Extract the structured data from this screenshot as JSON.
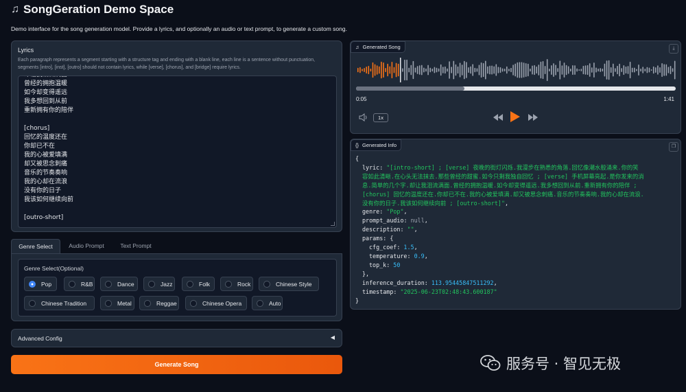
{
  "header": {
    "icon": "music-note-icon",
    "title": "SongGeration Demo Space",
    "description": "Demo interface for the song generation model. Provide a lyrics, and optionally an audio or text prompt, to generate a custom song."
  },
  "lyrics": {
    "label": "Lyrics",
    "info": "Each paragraph represents a segment starting with a structure tag and ending with a blank line, each line is a sentence without punctuation, segments [intro], [inst], [outro] should not contain lyrics, while [verse], [chorus], and [bridge] require lyrics.",
    "lines": [
      "却让我泪流满面",
      "曾经的拥抱温暖",
      "如今却变得遥远",
      "我多想回到从前",
      "重新拥有你的陪伴",
      "",
      "[chorus]",
      "回忆的温度还在",
      "你却已不在",
      "我的心被爱填满",
      "却又被思念刺痛",
      "音乐的节奏奏响",
      "我的心却在流浪",
      "没有你的日子",
      "我该如何继续向前",
      "",
      "[outro-short]"
    ]
  },
  "tabs": [
    "Genre Select",
    "Audio Prompt",
    "Text Prompt"
  ],
  "genre": {
    "title": "Genre Select(Optional)",
    "selected": "Pop",
    "options_row1": [
      "Pop",
      "R&B",
      "Dance",
      "Jazz",
      "Folk",
      "Rock",
      "Chinese Style"
    ],
    "options_row2": [
      "Chinese Tradition",
      "Metal",
      "Reggae",
      "Chinese Opera",
      "Auto"
    ]
  },
  "advanced": {
    "label": "Advanced Config",
    "arrow": "◀"
  },
  "generate_button": "Generate Song",
  "audio": {
    "label": "Generated Song",
    "current_time": "0:05",
    "duration": "1:41",
    "progress": 0.05,
    "speed": "1x",
    "icons": [
      "music-note-icon",
      "download-icon",
      "volume-icon",
      "rewind-icon",
      "play-icon",
      "fast-forward-icon"
    ]
  },
  "info": {
    "label": "Generated Info",
    "json_lines": [
      {
        "indent": 0,
        "parts": [
          {
            "t": "{",
            "c": "p"
          }
        ]
      },
      {
        "indent": 1,
        "parts": [
          {
            "t": "lyric:  ",
            "c": "k"
          },
          {
            "t": "\"[intro-short] ; [verse] 夜晚的街灯闪烁.我漫步在熟悉的角落.回忆像潮水般涌来.你的笑",
            "c": "s"
          }
        ]
      },
      {
        "indent": 1,
        "parts": [
          {
            "t": "容如此清晰.在心头无法抹去.那些曾经的甜蜜.如今只剩我独自回忆 ; [verse] 手机屏幕亮起.是你发来的消",
            "c": "s"
          }
        ]
      },
      {
        "indent": 1,
        "parts": [
          {
            "t": "息.简单的几个字.却让我泪流满面.曾经的拥抱温暖.如今却变得遥远.我多想回到从前.重新拥有你的陪伴 ;",
            "c": "s"
          }
        ]
      },
      {
        "indent": 1,
        "parts": [
          {
            "t": "[chorus] 回忆的温度还在.你却已不在.我的心被爱填满.却又被思念刺痛.音乐的节奏奏响.我的心却在流浪.",
            "c": "s"
          }
        ]
      },
      {
        "indent": 1,
        "parts": [
          {
            "t": "没有你的日子.我该如何继续向前 ; [outro-short]\"",
            "c": "s"
          },
          {
            "t": ",",
            "c": "p"
          }
        ]
      },
      {
        "indent": 1,
        "parts": [
          {
            "t": "genre:  ",
            "c": "k"
          },
          {
            "t": "\"Pop\"",
            "c": "s"
          },
          {
            "t": ",",
            "c": "p"
          }
        ]
      },
      {
        "indent": 1,
        "parts": [
          {
            "t": "prompt_audio:  ",
            "c": "k"
          },
          {
            "t": "null",
            "c": "nl"
          },
          {
            "t": ",",
            "c": "p"
          }
        ]
      },
      {
        "indent": 1,
        "parts": [
          {
            "t": "description:  ",
            "c": "k"
          },
          {
            "t": "\"\"",
            "c": "s"
          },
          {
            "t": ",",
            "c": "p"
          }
        ]
      },
      {
        "indent": 1,
        "parts": [
          {
            "t": "params:  {",
            "c": "k"
          }
        ]
      },
      {
        "indent": 2,
        "parts": [
          {
            "t": "cfg_coef:  ",
            "c": "k"
          },
          {
            "t": "1.5",
            "c": "n"
          },
          {
            "t": ",",
            "c": "p"
          }
        ]
      },
      {
        "indent": 2,
        "parts": [
          {
            "t": "temperature:  ",
            "c": "k"
          },
          {
            "t": "0.9",
            "c": "n"
          },
          {
            "t": ",",
            "c": "p"
          }
        ]
      },
      {
        "indent": 2,
        "parts": [
          {
            "t": "top_k:  ",
            "c": "k"
          },
          {
            "t": "50",
            "c": "n"
          }
        ]
      },
      {
        "indent": 1,
        "parts": [
          {
            "t": "},",
            "c": "p"
          }
        ]
      },
      {
        "indent": 1,
        "parts": [
          {
            "t": "inference_duration:  ",
            "c": "k"
          },
          {
            "t": "113.95445847511292",
            "c": "n"
          },
          {
            "t": ",",
            "c": "p"
          }
        ]
      },
      {
        "indent": 1,
        "parts": [
          {
            "t": "timestamp:  ",
            "c": "k"
          },
          {
            "t": "\"2025-06-23T02:48:43.600187\"",
            "c": "s"
          }
        ]
      },
      {
        "indent": 0,
        "parts": [
          {
            "t": "}",
            "c": "p"
          }
        ]
      }
    ]
  },
  "watermark": {
    "text": "服务号 · 智见无极",
    "icon": "wechat-icon"
  },
  "colors": {
    "accent": "#f97316",
    "background": "#0b0f19",
    "panel": "#1f2937",
    "string": "#22c55e",
    "number": "#38bdf8",
    "checked": "#3b82f6"
  }
}
